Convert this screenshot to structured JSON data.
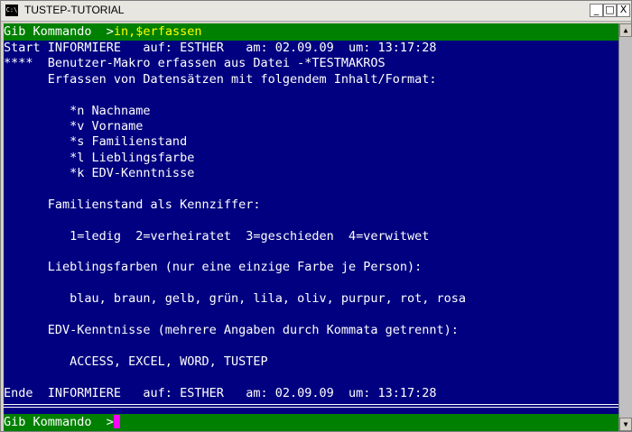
{
  "window": {
    "title": "TUSTEP-TUTORIAL",
    "icon_label": "C:\\",
    "buttons": {
      "minimize": "_",
      "maximize": "□",
      "close": "X"
    }
  },
  "console": {
    "prompt_top": {
      "label": "Gib Kommando  >",
      "command": "in,$erfassen"
    },
    "lines": [
      "Start INFORMIERE   auf: ESTHER   am: 02.09.09  um: 13:17:28",
      "****  Benutzer-Makro erfassen aus Datei -*TESTMAKROS",
      "      Erfassen von Datensätzen mit folgendem Inhalt/Format:",
      "",
      "         *n Nachname",
      "         *v Vorname",
      "         *s Familienstand",
      "         *l Lieblingsfarbe",
      "         *k EDV-Kenntnisse",
      "",
      "      Familienstand als Kennziffer:",
      "",
      "         1=ledig  2=verheiratet  3=geschieden  4=verwitwet",
      "",
      "      Lieblingsfarben (nur eine einzige Farbe je Person):",
      "",
      "         blau, braun, gelb, grün, lila, oliv, purpur, rot, rosa",
      "",
      "      EDV-Kenntnisse (mehrere Angaben durch Kommata getrennt):",
      "",
      "         ACCESS, EXCEL, WORD, TUSTEP",
      "",
      "Ende  INFORMIERE   auf: ESTHER   am: 02.09.09  um: 13:17:28"
    ],
    "prompt_bottom": {
      "label": "Gib Kommando  >"
    }
  },
  "colors": {
    "console_bg": "#000080",
    "prompt_bar_bg": "#008000",
    "command_text": "#ffff00",
    "cursor": "#ff00ff"
  },
  "scrollbar": {
    "up_icon": "▲",
    "down_icon": "▼"
  }
}
